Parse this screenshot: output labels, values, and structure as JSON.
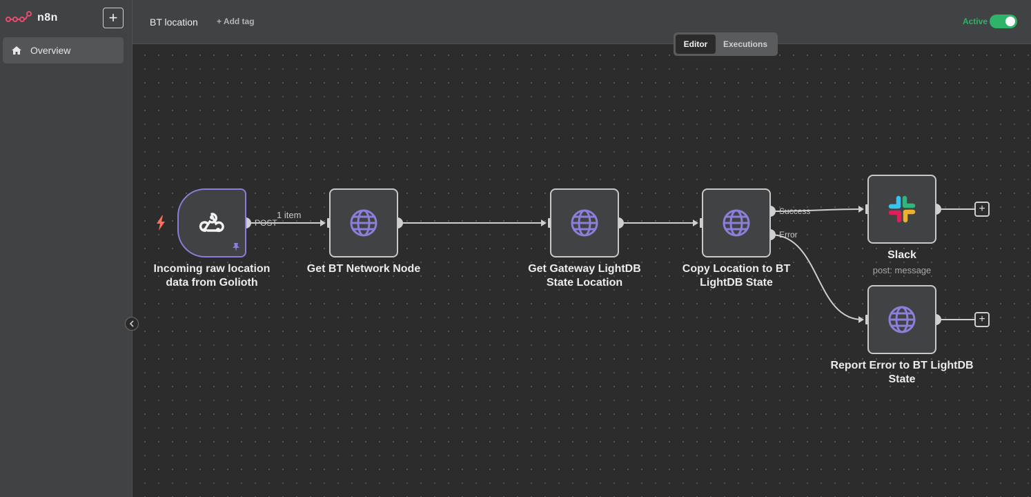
{
  "app": {
    "brand": "n8n"
  },
  "sidebar": {
    "overview_label": "Overview"
  },
  "header": {
    "workflow_name": "BT location",
    "add_tag": "+ Add tag",
    "active_label": "Active",
    "active": true
  },
  "tabs": {
    "editor": "Editor",
    "executions": "Executions",
    "selected": "Editor"
  },
  "nodes": {
    "webhook": {
      "label": "Incoming raw location data from Golioth",
      "icon": "webhook-icon"
    },
    "get_network_node": {
      "label": "Get BT Network Node",
      "icon": "globe-icon"
    },
    "get_gateway": {
      "label": "Get Gateway LightDB State Location",
      "icon": "globe-icon"
    },
    "copy_location": {
      "label": "Copy Location to BT LightDB State",
      "icon": "globe-icon"
    },
    "slack": {
      "label": "Slack",
      "sub": "post: message",
      "icon": "slack-icon"
    },
    "report_error": {
      "label": "Report Error to BT LightDB State",
      "icon": "globe-icon"
    }
  },
  "edges": {
    "post_label": "POST",
    "items_label": "1 item",
    "success_label": "Success",
    "error_label": "Error"
  },
  "colors": {
    "accent_purple": "#8b7fd9",
    "active_green": "#2fb36b",
    "trigger_red": "#ff6d5a",
    "logo_red": "#ea4b71"
  }
}
